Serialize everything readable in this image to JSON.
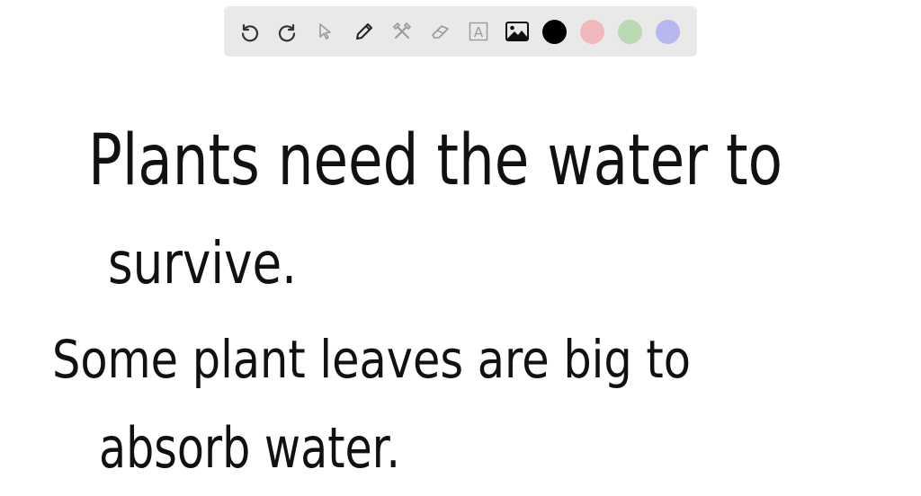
{
  "toolbar": {
    "tools": [
      {
        "name": "undo-icon"
      },
      {
        "name": "redo-icon"
      },
      {
        "name": "cursor-icon"
      },
      {
        "name": "pen-icon"
      },
      {
        "name": "tools-icon"
      },
      {
        "name": "eraser-icon"
      },
      {
        "name": "text-tool-icon"
      },
      {
        "name": "image-icon"
      }
    ],
    "colors": {
      "black": "#000000",
      "red": "#f0b8bb",
      "green": "#b9d9b2",
      "blue": "#b8b6ee"
    },
    "text_tool_glyph": "A"
  },
  "canvas": {
    "lines": [
      "Plants need the water to",
      "survive.",
      "Some plant leaves are big to",
      "absorb water."
    ]
  }
}
